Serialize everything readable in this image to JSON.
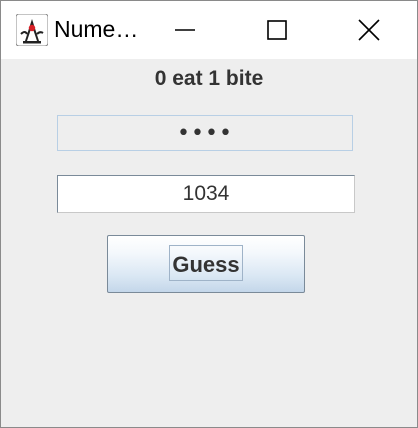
{
  "window": {
    "title": "Nume…",
    "app_icon": "java-duke-icon",
    "controls": {
      "minimize": "minimize-icon",
      "maximize": "maximize-icon",
      "close": "close-icon"
    }
  },
  "game": {
    "result_text": "0 eat 1 bite",
    "secret_value": "••••",
    "guess_value": "1034",
    "guess_button_label": "Guess"
  },
  "colors": {
    "content_background": "#eeeeee",
    "text": "#333333",
    "field_border": "#b8cfe5",
    "button_gradient_bottom": "#c4d7ea"
  }
}
